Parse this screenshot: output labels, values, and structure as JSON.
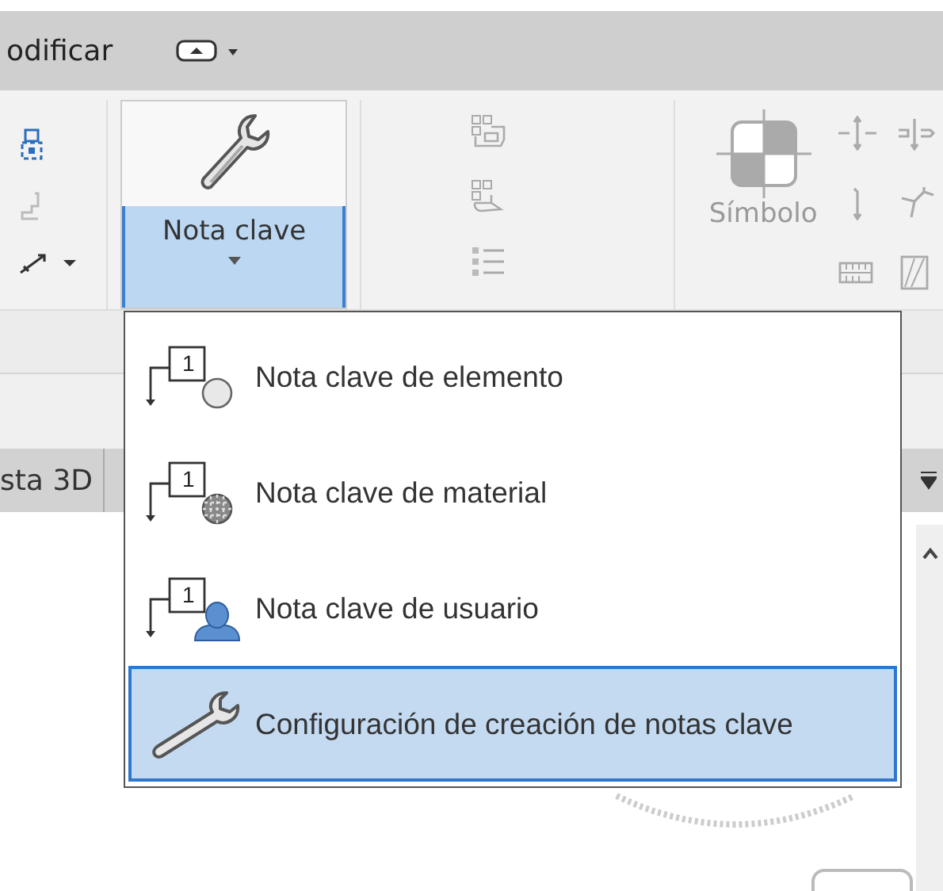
{
  "tab_bar": {
    "tab": "odificar"
  },
  "ribbon": {
    "keynote_button": {
      "label": "Nota clave",
      "pressed": true
    },
    "symbol_button": {
      "label": "Símbolo",
      "disabled": true
    }
  },
  "view_tab": {
    "label": "sta 3D"
  },
  "menu": {
    "items": [
      {
        "kind": "element",
        "tag": "1",
        "label": "Nota clave de elemento",
        "selected": false
      },
      {
        "kind": "material",
        "tag": "1",
        "label": "Nota clave de material",
        "selected": false
      },
      {
        "kind": "user",
        "tag": "1",
        "label": "Nota clave de usuario",
        "selected": false
      },
      {
        "kind": "settings",
        "label": "Configuración de creación de notas clave",
        "selected": true
      }
    ]
  }
}
